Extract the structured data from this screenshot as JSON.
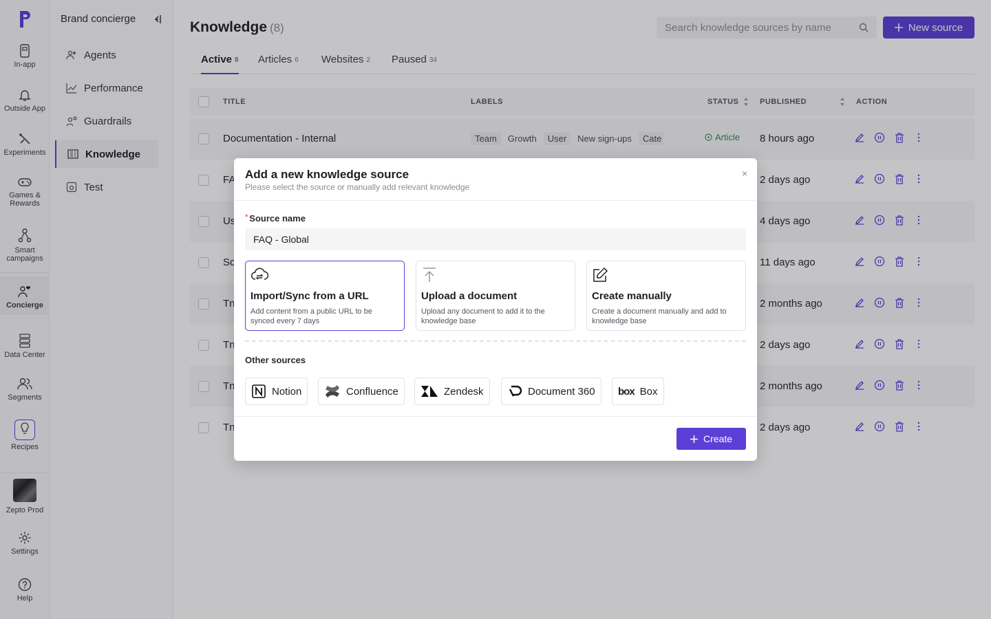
{
  "rail": {
    "items": [
      {
        "label": "In-app",
        "icon": "in-app-icon"
      },
      {
        "label": "Outside App",
        "icon": "bell-icon"
      },
      {
        "label": "Experiments",
        "icon": "experiments-icon"
      },
      {
        "label": "Games &\nRewards",
        "icon": "gamepad-icon"
      },
      {
        "label": "Smart\ncampaigns",
        "icon": "network-icon"
      },
      {
        "label": "Concierge",
        "icon": "concierge-icon"
      },
      {
        "label": "Data Center",
        "icon": "database-icon"
      },
      {
        "label": "Segments",
        "icon": "users-icon"
      },
      {
        "label": "Recipes",
        "icon": "lightbulb-icon"
      },
      {
        "label": "Zepto Prod",
        "icon": "avatar"
      },
      {
        "label": "Settings",
        "icon": "gear-icon"
      },
      {
        "label": "Help",
        "icon": "help-icon"
      }
    ]
  },
  "subnav": {
    "title": "Brand concierge",
    "items": [
      {
        "label": "Agents"
      },
      {
        "label": "Performance"
      },
      {
        "label": "Guardrails"
      },
      {
        "label": "Knowledge"
      },
      {
        "label": "Test"
      }
    ]
  },
  "header": {
    "title": "Knowledge",
    "count": "(8)",
    "search_placeholder": "Search knowledge sources by name",
    "new_label": "New source"
  },
  "tabs": [
    {
      "label": "Active",
      "count": "8"
    },
    {
      "label": "Articles",
      "count": "6"
    },
    {
      "label": "Websites",
      "count": "2"
    },
    {
      "label": "Paused",
      "count": "34"
    }
  ],
  "table": {
    "columns": [
      "TITLE",
      "LABELS",
      "STATUS",
      "PUBLISHED",
      "ACTION"
    ],
    "rows": [
      {
        "title": "Documentation - Internal",
        "labels": [
          "Team",
          "Growth",
          "User",
          "New sign-ups",
          "Cate"
        ],
        "status": "Article",
        "published": "8 hours ago"
      },
      {
        "title": "FA",
        "published": "2 days ago"
      },
      {
        "title": "Us",
        "published": "4 days ago"
      },
      {
        "title": "Sc",
        "published": "11 days ago"
      },
      {
        "title": "Tn",
        "published": "2 months ago"
      },
      {
        "title": "Tn",
        "published": "2 days ago"
      },
      {
        "title": "Tn",
        "published": "2 months ago"
      },
      {
        "title": "Tn",
        "published": "2 days ago"
      }
    ]
  },
  "modal": {
    "title": "Add a new knowledge source",
    "subtitle": "Please select the source or manually add relevant knowledge",
    "close": "×",
    "source_label": "Source name",
    "required_mark": "*",
    "source_value": "FAQ - Global",
    "cards": [
      {
        "title": "Import/Sync from a URL",
        "desc": "Add content from a public URL to be synced every 7 days"
      },
      {
        "title": "Upload a document",
        "desc": "Upload any document to add it to the knowledge base"
      },
      {
        "title": "Create manually",
        "desc": "Create a document manually and add to knowledge base"
      }
    ],
    "other_title": "Other sources",
    "other_sources": [
      {
        "label": "Notion"
      },
      {
        "label": "Confluence"
      },
      {
        "label": "Zendesk"
      },
      {
        "label": "Document 360"
      },
      {
        "label": "Box",
        "logo_text": "box"
      }
    ],
    "create_label": "Create"
  },
  "colors": {
    "accent": "#5b3fd6",
    "status_green": "#2f8a4a"
  }
}
